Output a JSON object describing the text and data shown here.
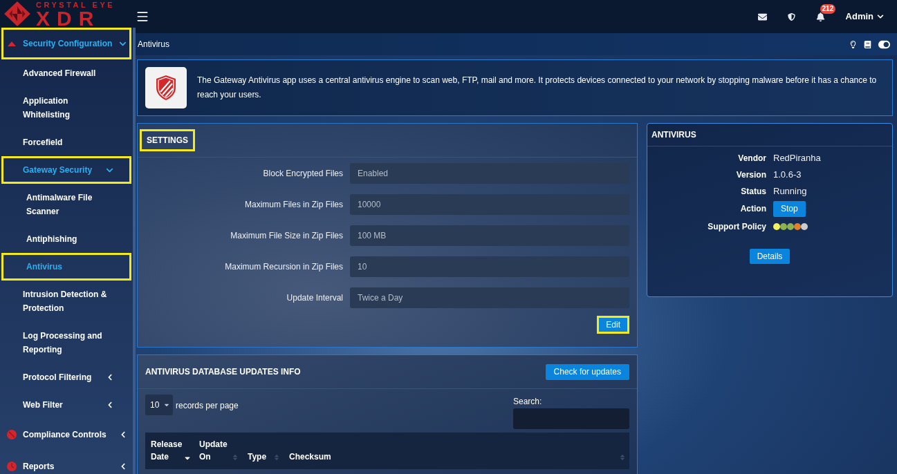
{
  "header": {
    "logo_caption": "CRYSTAL EYE",
    "logo_wordmark": "XDR",
    "notification_count": "212",
    "user": "Admin"
  },
  "sidebar": {
    "items": [
      {
        "label": "Security Configuration",
        "expanded": true,
        "highlighted": true,
        "children": [
          {
            "label": "Advanced Firewall",
            "selected": false,
            "highlighted": false
          },
          {
            "label": "Application Whitelisting",
            "selected": false,
            "highlighted": false
          },
          {
            "label": "Forcefield",
            "selected": false,
            "highlighted": false
          },
          {
            "label": "Gateway Security",
            "expanded": true,
            "highlighted": true,
            "children": [
              {
                "label": "Antimalware File Scanner",
                "selected": false,
                "highlighted": false
              },
              {
                "label": "Antiphishing",
                "selected": false,
                "highlighted": false
              },
              {
                "label": "Antivirus",
                "selected": true,
                "highlighted": true
              }
            ]
          },
          {
            "label": "Intrusion Detection & Protection",
            "selected": false,
            "highlighted": false
          },
          {
            "label": "Log Processing and Reporting",
            "selected": false,
            "highlighted": false
          },
          {
            "label": "Protocol Filtering",
            "expanded": false,
            "highlighted": false
          },
          {
            "label": "Web Filter",
            "expanded": false,
            "highlighted": false
          }
        ]
      },
      {
        "label": "Compliance Controls",
        "expanded": false,
        "highlighted": false
      },
      {
        "label": "Reports",
        "expanded": false,
        "highlighted": false
      }
    ]
  },
  "page": {
    "title": "Antivirus"
  },
  "info": {
    "text": "The Gateway Antivirus app uses a central antivirus engine to scan web, FTP, mail and more. It protects devices connected to your network by stopping malware before it has a chance to reach your users."
  },
  "settings": {
    "title": "SETTINGS",
    "title_highlighted": true,
    "fields": [
      {
        "label": "Block Encrypted Files",
        "value": "Enabled"
      },
      {
        "label": "Maximum Files in Zip Files",
        "value": "10000"
      },
      {
        "label": "Maximum File Size in Zip Files",
        "value": "100 MB"
      },
      {
        "label": "Maximum Recursion in Zip Files",
        "value": "10"
      },
      {
        "label": "Update Interval",
        "value": "Twice a Day"
      }
    ],
    "edit_button": {
      "label": "Edit",
      "highlighted": true
    }
  },
  "antivirus": {
    "title": "ANTIVIRUS",
    "rows": [
      {
        "kind": "text",
        "label": "Vendor",
        "value": "RedPiranha"
      },
      {
        "kind": "text",
        "label": "Version",
        "value": "1.0.6-3"
      },
      {
        "kind": "text",
        "label": "Status",
        "value": "Running"
      },
      {
        "kind": "button",
        "label": "Action",
        "value": "Stop"
      },
      {
        "kind": "dots",
        "label": "Support Policy",
        "dots": [
          {
            "color": "#f4ef5c"
          },
          {
            "color": "#8db250"
          },
          {
            "color": "#8db250"
          },
          {
            "color": "#e2802c"
          },
          {
            "color": "#cccccc"
          }
        ]
      }
    ],
    "details_button": "Details"
  },
  "updates": {
    "title": "ANTIVIRUS DATABASE UPDATES INFO",
    "check_button": "Check for updates",
    "page_size": "10",
    "page_size_label": "records per page",
    "search_label": "Search:",
    "columns": [
      {
        "label": "Release Date",
        "sorted": true
      },
      {
        "label": "Update On",
        "sorted": false
      },
      {
        "label": "Type",
        "sorted": false
      },
      {
        "label": "Checksum",
        "sorted": false
      }
    ]
  }
}
